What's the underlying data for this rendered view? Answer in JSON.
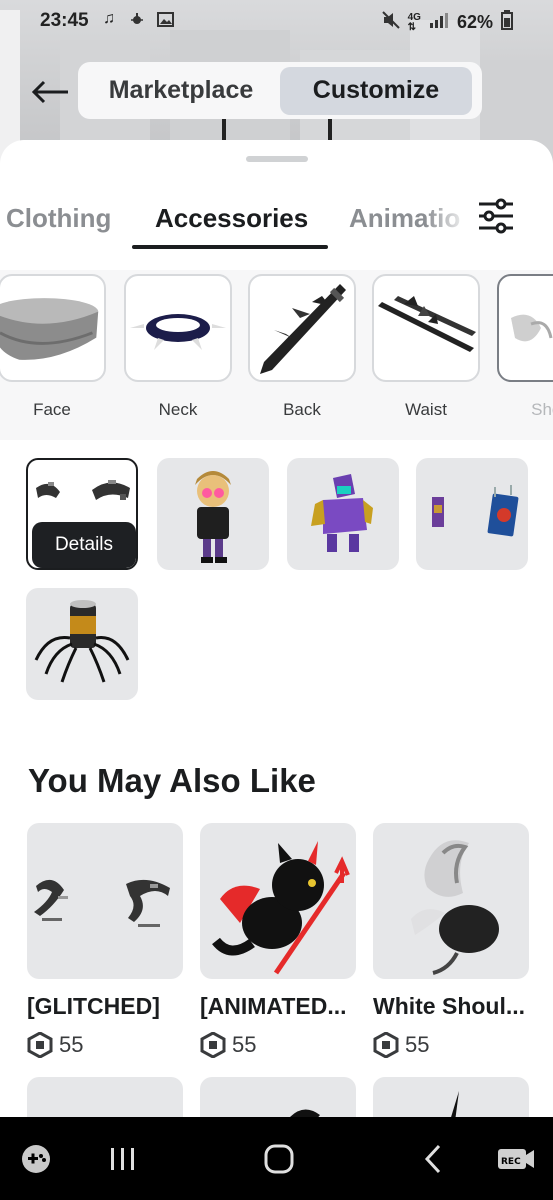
{
  "status": {
    "time": "23:45",
    "left_icons": [
      "music-note-icon",
      "bug-icon",
      "image-icon"
    ],
    "right_icons": [
      "mute-icon",
      "4g-icon",
      "signal-icon"
    ],
    "battery": "62%"
  },
  "header": {
    "segments": [
      {
        "label": "Marketplace",
        "active": false
      },
      {
        "label": "Customize",
        "active": true
      }
    ]
  },
  "tabs": [
    {
      "label": "Clothing",
      "active": false
    },
    {
      "label": "Accessories",
      "active": true
    },
    {
      "label": "Animatio",
      "active": false
    }
  ],
  "subcategories": [
    {
      "label": "Face",
      "icon": "bandana-icon"
    },
    {
      "label": "Neck",
      "icon": "spiked-collar-icon"
    },
    {
      "label": "Back",
      "icon": "sword-icon"
    },
    {
      "label": "Waist",
      "icon": "twin-swords-icon"
    },
    {
      "label": "Shou",
      "icon": "shoulder-icon"
    }
  ],
  "items": [
    {
      "name": "glitched-accessory",
      "selected": true
    },
    {
      "name": "goggles-avatar"
    },
    {
      "name": "armored-creature"
    },
    {
      "name": "floating-books"
    },
    {
      "name": "spider-can"
    }
  ],
  "details_label": "Details",
  "you_may_also_like": {
    "title": "You May Also Like",
    "items": [
      {
        "name": "[GLITCHED]",
        "price": "55"
      },
      {
        "name": "[ANIMATED...",
        "price": "55"
      },
      {
        "name": "White Shoul...",
        "price": "55"
      }
    ]
  },
  "navbar": {
    "buttons": [
      "game-launcher-icon",
      "recents-icon",
      "home-icon",
      "back-icon",
      "rec-icon"
    ],
    "rec_label": "REC"
  }
}
